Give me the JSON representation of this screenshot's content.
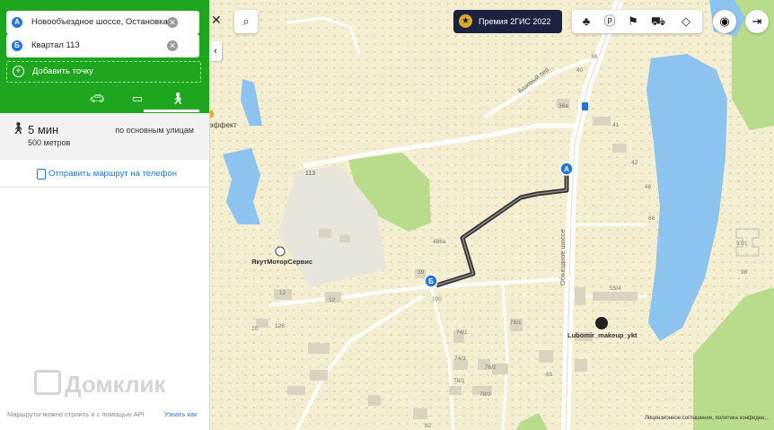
{
  "route_panel": {
    "point_a": {
      "badge": "А",
      "value": "Новообъездное шоссе, Остановка"
    },
    "point_b": {
      "badge": "Б",
      "value": "Квартал 113"
    },
    "add_point_label": "Добавить точку",
    "transport_modes": [
      "car-icon",
      "bus-icon",
      "walk-icon"
    ],
    "selected_mode": "walk",
    "summary": {
      "time": "5 мин",
      "distance": "500 метров",
      "note": "по основным улицам"
    },
    "send_to_phone": "Отправить маршрут на телефон",
    "footer": {
      "api_text": "Маршруты можно строить и с помощью API",
      "learn_more": "Узнать как"
    },
    "watermark": "Домклик"
  },
  "map_controls": {
    "award_label": "Премия 2ГИС 2022",
    "layer_icons": [
      "tree-icon",
      "parking-icon",
      "sign-icon",
      "car-traffic-icon",
      "layers-icon"
    ],
    "close_symbol": "✕",
    "collapse_symbol": "‹"
  },
  "map_labels": {
    "poi_effect": "эффект",
    "poi_yakut": "ЯкутМоторСервис",
    "poi_lubomir": "Lubomir_makeup_ykt",
    "road_bazovy": "Базовый пер.",
    "road_obezdnoe": "Объездное шоссе",
    "label_113": "113",
    "marker_a": "А",
    "marker_b": "Б",
    "legal": "Лицензионное соглашение, политика конфиден...",
    "house_numbers": [
      "36a",
      "41",
      "38",
      "40",
      "42",
      "46",
      "66",
      "39",
      "100",
      "486a",
      "12",
      "12",
      "10",
      "126",
      "74/1",
      "76/1",
      "74/3",
      "76/2",
      "78/1",
      "78/3",
      "65",
      "55/4",
      "97/1",
      "98",
      "82"
    ]
  },
  "colors": {
    "accent_green": "#1ea61e",
    "link_blue": "#2376d5",
    "water": "#8dc4ef",
    "route": "#333333",
    "award_bg": "#1c2340"
  }
}
